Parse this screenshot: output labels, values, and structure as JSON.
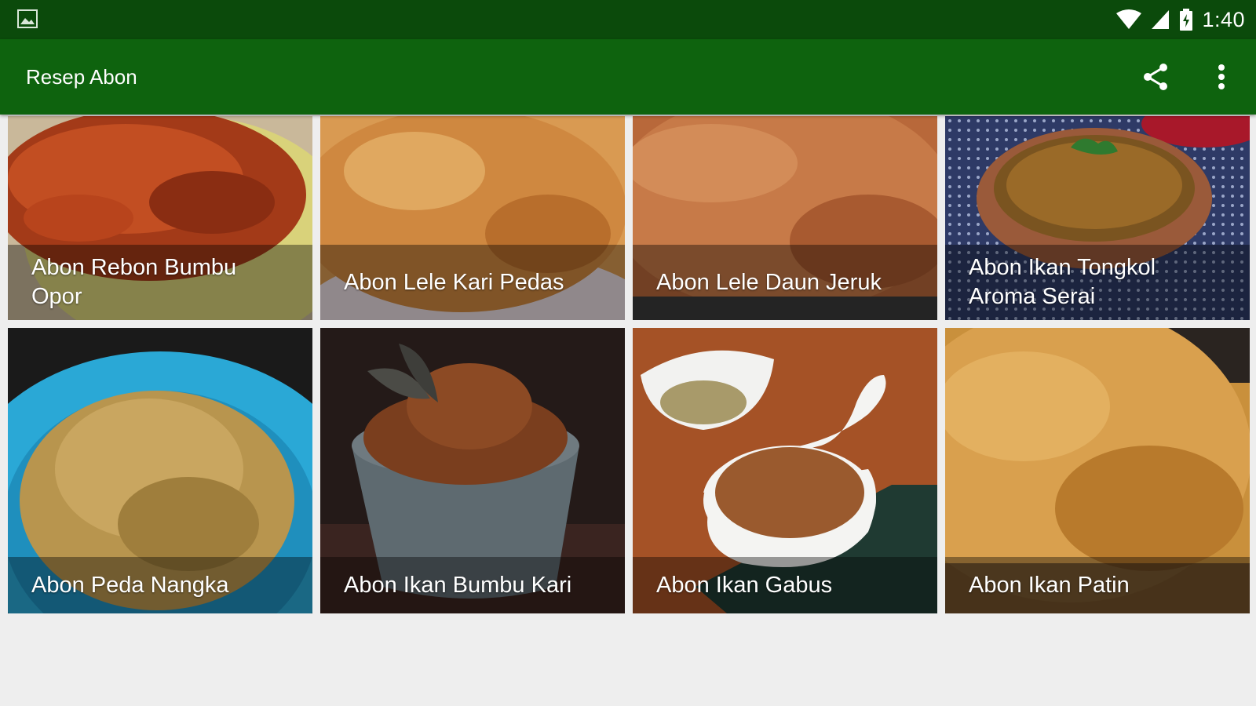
{
  "status_bar": {
    "time": "1:40",
    "icons": [
      "image-icon",
      "wifi-icon",
      "cell-signal-icon",
      "battery-icon"
    ]
  },
  "app_bar": {
    "title": "Resep Abon",
    "actions": [
      "share-icon",
      "more-vert-icon"
    ]
  },
  "recipes": [
    {
      "title": "Abon Rebon Bumbu Opor"
    },
    {
      "title": "Abon Lele Kari Pedas"
    },
    {
      "title": "Abon Lele Daun Jeruk"
    },
    {
      "title": "Abon Ikan Tongkol Aroma Serai"
    },
    {
      "title": "Abon Peda Nangka"
    },
    {
      "title": "Abon Ikan Bumbu Kari"
    },
    {
      "title": "Abon Ikan Gabus"
    },
    {
      "title": "Abon Ikan Patin"
    }
  ],
  "colors": {
    "status_bar": "#0b4a0b",
    "app_bar": "#0e630e",
    "background": "#eeeeee"
  }
}
